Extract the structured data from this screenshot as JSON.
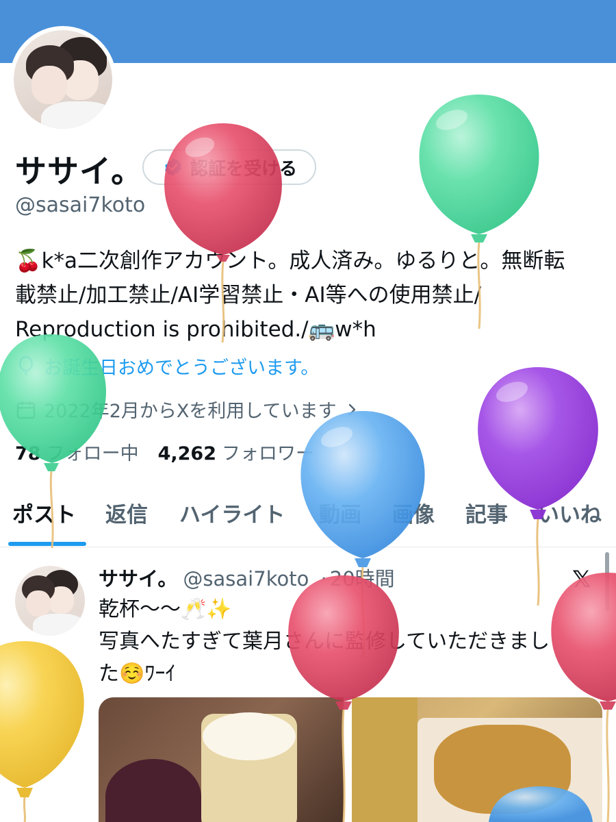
{
  "profile": {
    "name": "ササイ。",
    "verify_button_label": "認証を受ける",
    "handle": "@sasai7koto",
    "bio_lines": [
      "🍒k*a二次創作アカウント。成人済み。ゆるりと。無断転",
      "載禁止/加工禁止/AI学習禁止・AI等への使用禁止/",
      "Reproduction is prohibited./🚌w*h"
    ],
    "birthday_text": "お誕生日おめでとうございます。",
    "joined_text": "2022年2月からXを利用しています",
    "following_count": "78",
    "following_label": "フォロー中",
    "followers_count": "4,262",
    "followers_label": "フォロワー"
  },
  "tabs": [
    {
      "label": "ポスト",
      "active": true
    },
    {
      "label": "返信"
    },
    {
      "label": "ハイライト"
    },
    {
      "label": "動画"
    },
    {
      "label": "画像"
    },
    {
      "label": "記事"
    },
    {
      "label": "いいね"
    }
  ],
  "post": {
    "author_name": "ササイ。",
    "author_handle": "@sasai7koto",
    "separator": "·",
    "time": "20時間",
    "text_lines": [
      "乾杯〜〜🥂✨",
      "写真へたすぎて葉月さんに監修していただきまし",
      "た☺️ﾜｰｲ"
    ]
  },
  "colors": {
    "banner": "#4a90d9",
    "accent": "#1d9bf0",
    "text_primary": "#0f1419",
    "text_secondary": "#536471",
    "balloon_red": "#e8526e",
    "balloon_green": "#5fe0a8",
    "balloon_blue": "#6ab4f3",
    "balloon_purple": "#a24ee6",
    "balloon_yellow": "#f8d24c"
  },
  "icons": {
    "verify": "verified-badge-icon",
    "birthday": "balloon-icon",
    "joined": "calendar-icon",
    "chevron": "chevron-right-icon",
    "x_logo": "x-logo-icon"
  }
}
